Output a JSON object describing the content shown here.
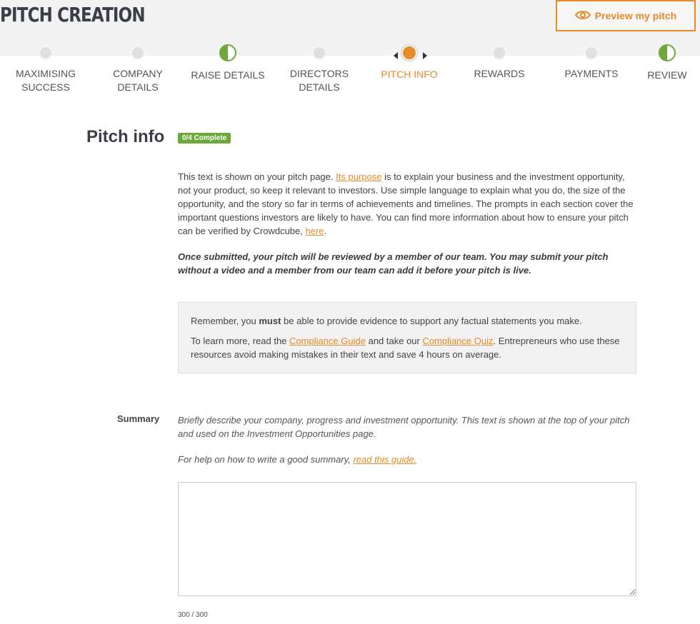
{
  "header": {
    "title": "PITCH CREATION",
    "preview_label": "Preview my pitch"
  },
  "steps": [
    {
      "line1": "MAXIMISING",
      "line2": "SUCCESS",
      "state": "empty"
    },
    {
      "line1": "COMPANY",
      "line2": "DETAILS",
      "state": "empty"
    },
    {
      "line1": "RAISE DETAILS",
      "line2": "",
      "state": "half"
    },
    {
      "line1": "DIRECTORS",
      "line2": "DETAILS",
      "state": "empty"
    },
    {
      "line1": "PITCH INFO",
      "line2": "",
      "state": "active"
    },
    {
      "line1": "REWARDS",
      "line2": "",
      "state": "empty"
    },
    {
      "line1": "PAYMENTS",
      "line2": "",
      "state": "empty"
    },
    {
      "line1": "REVIEW",
      "line2": "",
      "state": "half"
    }
  ],
  "section": {
    "title": "Pitch info",
    "badge": "0/4 Complete"
  },
  "intro": {
    "t1": "This text is shown on your pitch page. ",
    "link1": "Its purpose",
    "t2": " is to explain your business and the investment opportunity, not your product, so keep it relevant to investors. Use simple language to explain what you do, the size of the opportunity, and the story so far in terms of achievements and timelines. The prompts in each section cover the important questions investors are likely to have. You can find more information about how to ensure your pitch can be verified by Crowdcube, ",
    "link2": "here",
    "t3": ".",
    "emphasis": "Once submitted, your pitch will be reviewed by a member of our team. You may submit your pitch without a video and a member from our team can add it before your pitch is live."
  },
  "notice": {
    "n1a": "Remember, you ",
    "n1b": "must",
    "n1c": " be able to provide evidence to support any factual statements you make.",
    "n2a": "To learn more, read the ",
    "n2link1": "Compliance Guide",
    "n2b": " and take our ",
    "n2link2": "Compliance Quiz",
    "n2c": ". Entrepreneurs who use these resources avoid making mistakes in their text and save 4 hours on average."
  },
  "summary": {
    "label": "Summary",
    "help": "Briefly describe your company, progress and investment opportunity. This text is shown at the top of your pitch and used on the Investment Opportunities page.",
    "guide_text": "For help on how to write a good summary, ",
    "guide_link": "read this guide.",
    "value": "",
    "counter": "300 / 300"
  },
  "colors": {
    "accent": "#e8892a",
    "success": "#6ea83a"
  }
}
